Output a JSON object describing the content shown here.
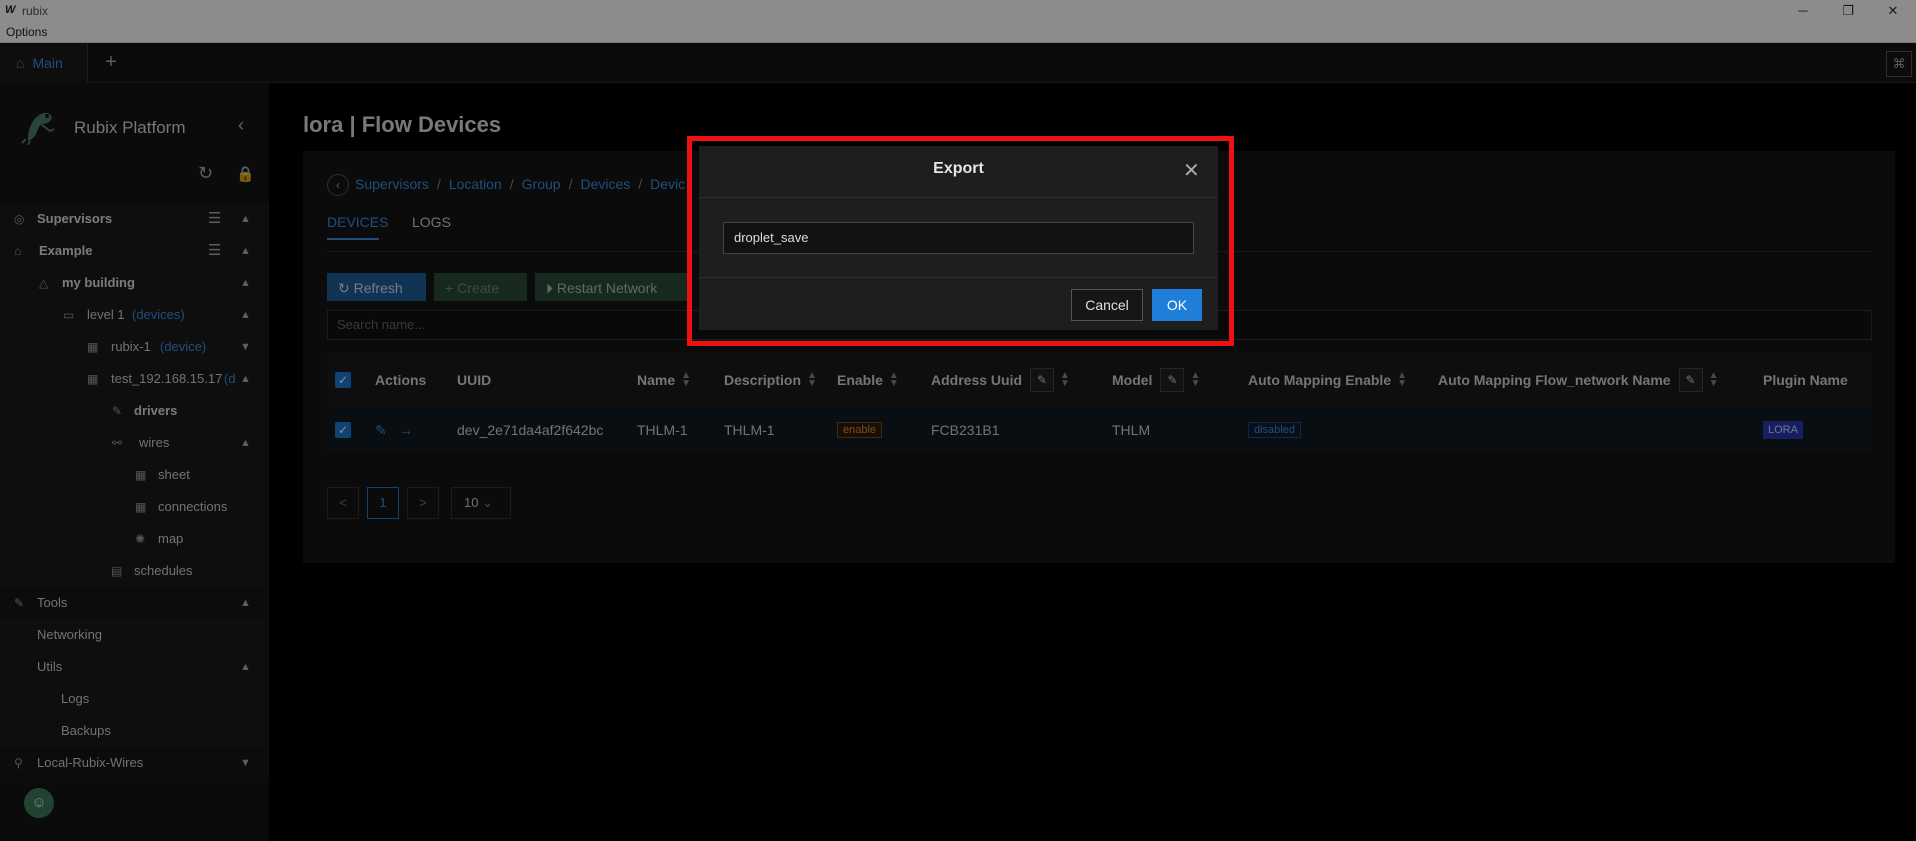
{
  "window": {
    "logo": "W",
    "title": "rubix",
    "minimize": "─",
    "restore": "❐",
    "close": "✕"
  },
  "menubar": {
    "options": "Options"
  },
  "tabbar": {
    "main_tab": "Main",
    "add_tab": "+",
    "right_icon": "⌘"
  },
  "sidebar": {
    "brand": "Rubix Platform",
    "collapse_icon": "‹",
    "refresh_icon": "↻",
    "lock_icon": "🔒",
    "items": [
      {
        "label": "Supervisors"
      },
      {
        "label": "Example"
      },
      {
        "label": "my building"
      },
      {
        "label": "level 1",
        "suffix": "(devices)"
      },
      {
        "label": "rubix-1",
        "suffix": "(device)"
      },
      {
        "label": "test_192.168.15.17",
        "suffix": "(d"
      },
      {
        "label": "drivers"
      },
      {
        "label": "wires"
      },
      {
        "label": "sheet"
      },
      {
        "label": "connections"
      },
      {
        "label": "map"
      },
      {
        "label": "schedules"
      },
      {
        "label": "Tools"
      },
      {
        "label": "Networking"
      },
      {
        "label": "Utils"
      },
      {
        "label": "Logs"
      },
      {
        "label": "Backups"
      },
      {
        "label": "Local-Rubix-Wires"
      }
    ]
  },
  "main": {
    "title": "lora | Flow Devices",
    "breadcrumb": [
      "Supervisors",
      "Location",
      "Group",
      "Devices",
      "Devic"
    ],
    "tabs": [
      "DEVICES",
      "LOGS"
    ],
    "buttons": {
      "refresh": "Refresh",
      "create": "Create",
      "restart": "Restart Network"
    },
    "search_placeholder": "Search name...",
    "table": {
      "headers": [
        "Actions",
        "UUID",
        "Name",
        "Description",
        "Enable",
        "Address Uuid",
        "Model",
        "Auto Mapping Enable",
        "Auto Mapping Flow_network Name",
        "Plugin Name"
      ],
      "rows": [
        {
          "uuid": "dev_2e71da4af2f642bc",
          "name": "THLM-1",
          "description": "THLM-1",
          "enable": "enable",
          "address_uuid": "FCB231B1",
          "model": "THLM",
          "auto_mapping_enable": "disabled",
          "auto_mapping_flow_network_name": "",
          "plugin_name": "LORA"
        }
      ]
    },
    "pagination": {
      "prev": "<",
      "page": "1",
      "next": ">",
      "page_size": "10"
    }
  },
  "modal": {
    "title": "Export",
    "close": "✕",
    "input_value": "droplet_save",
    "cancel": "Cancel",
    "ok": "OK"
  },
  "colors": {
    "accent": "#3b8ee0",
    "highlight_border": "#ee1111",
    "ok_button": "#1f7fd8",
    "sidebar_bg": "#141414"
  }
}
